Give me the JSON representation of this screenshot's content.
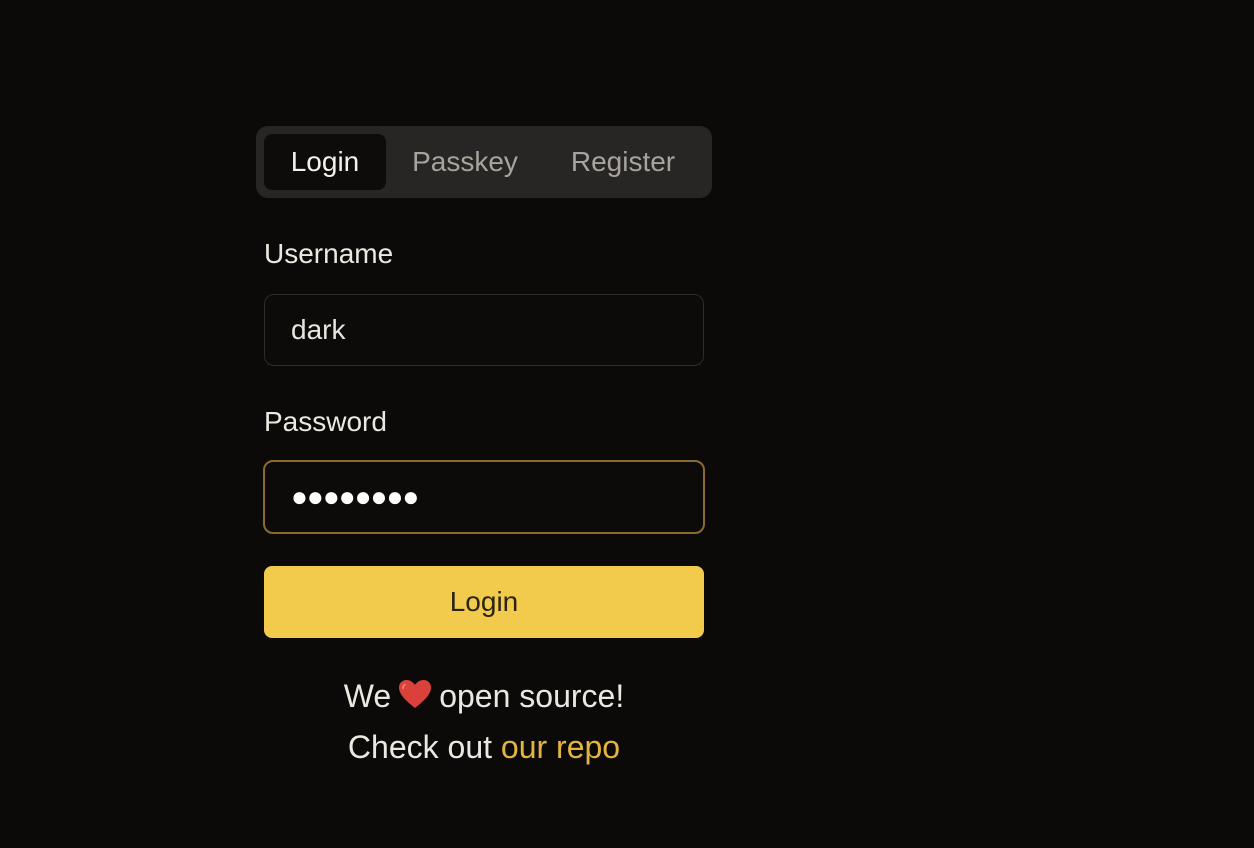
{
  "tabs": [
    {
      "label": "Login",
      "active": true
    },
    {
      "label": "Passkey",
      "active": false
    },
    {
      "label": "Register",
      "active": false
    }
  ],
  "form": {
    "username_label": "Username",
    "username_value": "dark",
    "password_label": "Password",
    "password_masked": "●●●●●●●●",
    "submit_label": "Login"
  },
  "footer": {
    "line1_before": "We",
    "line1_after": "open source!",
    "line2_before": "Check out",
    "link_text": "our repo"
  },
  "colors": {
    "background": "#0b0a09",
    "accent": "#f2cb4c",
    "link": "#e2b53e",
    "heart": "#d9413a"
  },
  "icons": {
    "heart": "heart-icon"
  }
}
